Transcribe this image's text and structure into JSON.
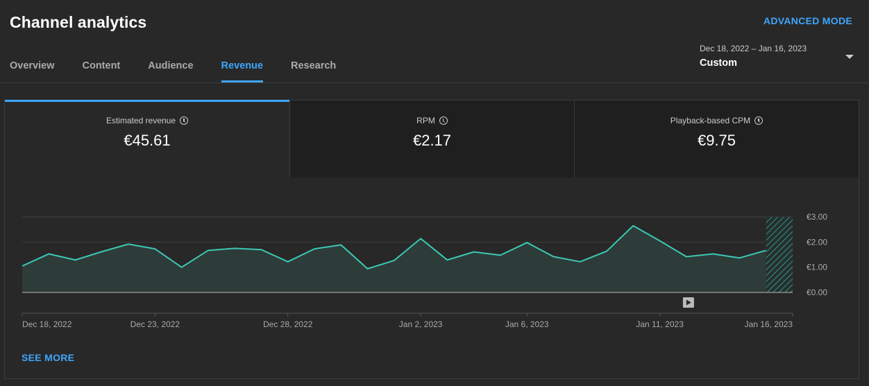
{
  "header": {
    "title": "Channel analytics",
    "advanced_mode": "ADVANCED MODE"
  },
  "tabs": [
    {
      "label": "Overview",
      "active": false
    },
    {
      "label": "Content",
      "active": false
    },
    {
      "label": "Audience",
      "active": false
    },
    {
      "label": "Revenue",
      "active": true
    },
    {
      "label": "Research",
      "active": false
    }
  ],
  "date_picker": {
    "range": "Dec 18, 2022 – Jan 16, 2023",
    "label": "Custom",
    "icon": "dropdown-caret-icon"
  },
  "metrics": [
    {
      "label": "Estimated revenue",
      "value": "€45.61",
      "icon": "clock-icon",
      "active": true
    },
    {
      "label": "RPM",
      "value": "€2.17",
      "icon": "clock-icon",
      "active": false
    },
    {
      "label": "Playback-based CPM",
      "value": "€9.75",
      "icon": "clock-icon",
      "active": false
    }
  ],
  "see_more": "SEE MORE",
  "colors": {
    "accent": "#3ea6ff",
    "line": "#3cc9b4",
    "area": "#2e3c39",
    "background": "#282828"
  },
  "chart_data": {
    "type": "area",
    "x": [
      "2022-12-18",
      "2022-12-19",
      "2022-12-20",
      "2022-12-21",
      "2022-12-22",
      "2022-12-23",
      "2022-12-24",
      "2022-12-25",
      "2022-12-26",
      "2022-12-27",
      "2022-12-28",
      "2022-12-29",
      "2022-12-30",
      "2022-12-31",
      "2023-01-01",
      "2023-01-02",
      "2023-01-03",
      "2023-01-04",
      "2023-01-05",
      "2023-01-06",
      "2023-01-07",
      "2023-01-08",
      "2023-01-09",
      "2023-01-10",
      "2023-01-11",
      "2023-01-12",
      "2023-01-13",
      "2023-01-14",
      "2023-01-15",
      "2023-01-16"
    ],
    "series": [
      {
        "values": [
          1.05,
          1.53,
          1.29,
          1.62,
          1.92,
          1.73,
          1.0,
          1.67,
          1.75,
          1.7,
          1.22,
          1.73,
          1.89,
          0.94,
          1.27,
          2.14,
          1.29,
          1.61,
          1.48,
          1.98,
          1.42,
          1.22,
          1.64,
          2.65,
          2.05,
          1.42,
          1.53,
          1.37,
          1.67,
          1.67
        ]
      }
    ],
    "yticks": [
      "€0.00",
      "€1.00",
      "€2.00",
      "€3.00"
    ],
    "ylim": [
      0,
      3
    ],
    "xticks": [
      {
        "label": "Dec 18, 2022",
        "index": 0
      },
      {
        "label": "Dec 23, 2022",
        "index": 5
      },
      {
        "label": "Dec 28, 2022",
        "index": 10
      },
      {
        "label": "Jan 2, 2023",
        "index": 15
      },
      {
        "label": "Jan 6, 2023",
        "index": 19
      },
      {
        "label": "Jan 11, 2023",
        "index": 24
      },
      {
        "label": "Jan 16, 2023",
        "index": 29
      }
    ],
    "estimated_last_point": true,
    "event_marker": {
      "index": 25,
      "icon": "video-play-icon"
    },
    "grid": true
  }
}
